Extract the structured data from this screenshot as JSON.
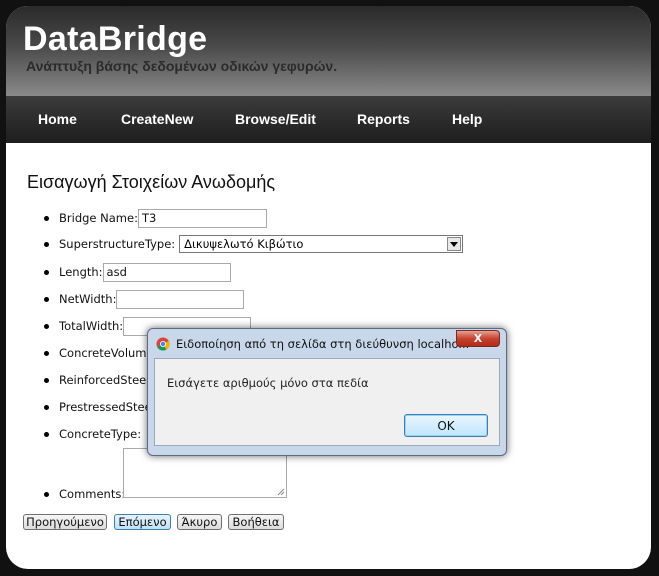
{
  "header": {
    "title": "DataBridge",
    "subtitle": "Ανάπτυξη βάσης δεδομένων οδικών γεφυρών."
  },
  "nav": {
    "items": [
      "Home",
      "CreateNew",
      "Browse/Edit",
      "Reports",
      "Help"
    ]
  },
  "form": {
    "heading": "Εισαγωγή Στοιχείων Ανωδομής",
    "fields": {
      "bridge_name": {
        "label": "Bridge Name:",
        "value": "T3"
      },
      "superstructure_type": {
        "label": "SuperstructureType:",
        "value": "Δικυψελωτό Κιβώτιο"
      },
      "length": {
        "label": "Length:",
        "value": "asd"
      },
      "net_width": {
        "label": "NetWidth:",
        "value": ""
      },
      "total_width": {
        "label": "TotalWidth:",
        "value": ""
      },
      "concrete_volume": {
        "label": "ConcreteVolume"
      },
      "reinforced_steel": {
        "label": "ReinforcedSteel"
      },
      "prestressed_steel": {
        "label": "PrestressedSteel"
      },
      "concrete_type": {
        "label": "ConcreteType:"
      },
      "comments": {
        "label": "Comments:",
        "value": ""
      }
    },
    "buttons": {
      "previous": "Προηγούμενο",
      "next": "Επόμενο",
      "cancel": "Άκυρο",
      "help": "Βοήθεια"
    }
  },
  "dialog": {
    "title": "Ειδοποίηση από τη σελίδα στη διεύθυνση localho...",
    "message": "Εισάγετε αριθμούς μόνο στα πεδία",
    "ok_label": "OK",
    "close_label": "X"
  },
  "colors": {
    "header_top": "#2a2a2a",
    "nav_bg": "#2c2c2c",
    "dialog_frame": "#c8d7ea",
    "close_red": "#c7432f"
  }
}
